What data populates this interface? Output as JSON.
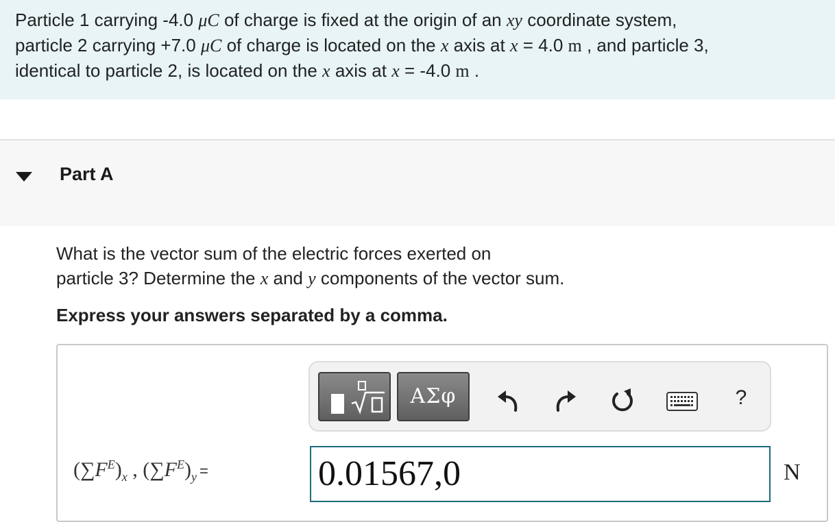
{
  "problem": {
    "line1": [
      "Particle 1 carrying -4.0 ",
      "μC",
      " of charge is fixed at the origin of an ",
      "xy",
      " coordinate system,"
    ],
    "line2": [
      "particle 2 carrying +7.0 ",
      "μC",
      " of charge is located on the ",
      "x",
      " axis at ",
      "x",
      " = 4.0 ",
      "m",
      " , and particle 3,"
    ],
    "line3": [
      "identical to particle 2, is located on the ",
      "x",
      " axis at ",
      "x",
      " = -4.0 ",
      "m",
      " ."
    ]
  },
  "part": {
    "title": "Part A"
  },
  "question": {
    "line1": "What is the vector sum of the electric forces exerted on",
    "line2": [
      "particle 3? Determine the ",
      "x",
      " and ",
      "y",
      " components of the vector sum."
    ],
    "instruction": "Express your answers separated by a comma."
  },
  "toolbar": {
    "symbols_label": "ΑΣφ",
    "help_label": "?"
  },
  "answer": {
    "label": {
      "open1": "(∑",
      "F1": "F",
      "sup1": "E",
      "close1": ")",
      "sub1": "x",
      "sep": " , ",
      "open2": "(∑",
      "F2": "F",
      "sup2": "E",
      "close2": ")",
      "sub2": "y",
      "eq": "="
    },
    "value": "0.01567,0",
    "unit": "N"
  }
}
